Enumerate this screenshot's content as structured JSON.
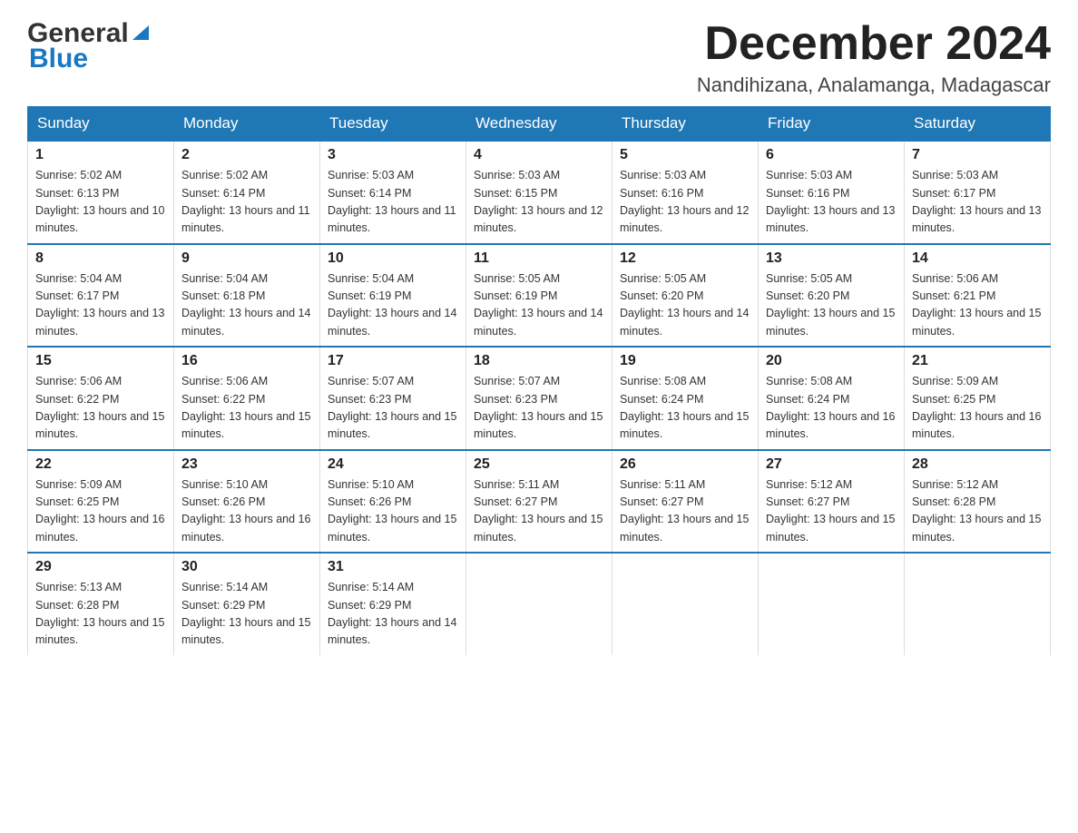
{
  "logo": {
    "general": "General",
    "blue": "Blue"
  },
  "title": "December 2024",
  "location": "Nandihizana, Analamanga, Madagascar",
  "weekdays": [
    "Sunday",
    "Monday",
    "Tuesday",
    "Wednesday",
    "Thursday",
    "Friday",
    "Saturday"
  ],
  "weeks": [
    [
      {
        "day": "1",
        "sunrise": "5:02 AM",
        "sunset": "6:13 PM",
        "daylight": "13 hours and 10 minutes."
      },
      {
        "day": "2",
        "sunrise": "5:02 AM",
        "sunset": "6:14 PM",
        "daylight": "13 hours and 11 minutes."
      },
      {
        "day": "3",
        "sunrise": "5:03 AM",
        "sunset": "6:14 PM",
        "daylight": "13 hours and 11 minutes."
      },
      {
        "day": "4",
        "sunrise": "5:03 AM",
        "sunset": "6:15 PM",
        "daylight": "13 hours and 12 minutes."
      },
      {
        "day": "5",
        "sunrise": "5:03 AM",
        "sunset": "6:16 PM",
        "daylight": "13 hours and 12 minutes."
      },
      {
        "day": "6",
        "sunrise": "5:03 AM",
        "sunset": "6:16 PM",
        "daylight": "13 hours and 13 minutes."
      },
      {
        "day": "7",
        "sunrise": "5:03 AM",
        "sunset": "6:17 PM",
        "daylight": "13 hours and 13 minutes."
      }
    ],
    [
      {
        "day": "8",
        "sunrise": "5:04 AM",
        "sunset": "6:17 PM",
        "daylight": "13 hours and 13 minutes."
      },
      {
        "day": "9",
        "sunrise": "5:04 AM",
        "sunset": "6:18 PM",
        "daylight": "13 hours and 14 minutes."
      },
      {
        "day": "10",
        "sunrise": "5:04 AM",
        "sunset": "6:19 PM",
        "daylight": "13 hours and 14 minutes."
      },
      {
        "day": "11",
        "sunrise": "5:05 AM",
        "sunset": "6:19 PM",
        "daylight": "13 hours and 14 minutes."
      },
      {
        "day": "12",
        "sunrise": "5:05 AM",
        "sunset": "6:20 PM",
        "daylight": "13 hours and 14 minutes."
      },
      {
        "day": "13",
        "sunrise": "5:05 AM",
        "sunset": "6:20 PM",
        "daylight": "13 hours and 15 minutes."
      },
      {
        "day": "14",
        "sunrise": "5:06 AM",
        "sunset": "6:21 PM",
        "daylight": "13 hours and 15 minutes."
      }
    ],
    [
      {
        "day": "15",
        "sunrise": "5:06 AM",
        "sunset": "6:22 PM",
        "daylight": "13 hours and 15 minutes."
      },
      {
        "day": "16",
        "sunrise": "5:06 AM",
        "sunset": "6:22 PM",
        "daylight": "13 hours and 15 minutes."
      },
      {
        "day": "17",
        "sunrise": "5:07 AM",
        "sunset": "6:23 PM",
        "daylight": "13 hours and 15 minutes."
      },
      {
        "day": "18",
        "sunrise": "5:07 AM",
        "sunset": "6:23 PM",
        "daylight": "13 hours and 15 minutes."
      },
      {
        "day": "19",
        "sunrise": "5:08 AM",
        "sunset": "6:24 PM",
        "daylight": "13 hours and 15 minutes."
      },
      {
        "day": "20",
        "sunrise": "5:08 AM",
        "sunset": "6:24 PM",
        "daylight": "13 hours and 16 minutes."
      },
      {
        "day": "21",
        "sunrise": "5:09 AM",
        "sunset": "6:25 PM",
        "daylight": "13 hours and 16 minutes."
      }
    ],
    [
      {
        "day": "22",
        "sunrise": "5:09 AM",
        "sunset": "6:25 PM",
        "daylight": "13 hours and 16 minutes."
      },
      {
        "day": "23",
        "sunrise": "5:10 AM",
        "sunset": "6:26 PM",
        "daylight": "13 hours and 16 minutes."
      },
      {
        "day": "24",
        "sunrise": "5:10 AM",
        "sunset": "6:26 PM",
        "daylight": "13 hours and 15 minutes."
      },
      {
        "day": "25",
        "sunrise": "5:11 AM",
        "sunset": "6:27 PM",
        "daylight": "13 hours and 15 minutes."
      },
      {
        "day": "26",
        "sunrise": "5:11 AM",
        "sunset": "6:27 PM",
        "daylight": "13 hours and 15 minutes."
      },
      {
        "day": "27",
        "sunrise": "5:12 AM",
        "sunset": "6:27 PM",
        "daylight": "13 hours and 15 minutes."
      },
      {
        "day": "28",
        "sunrise": "5:12 AM",
        "sunset": "6:28 PM",
        "daylight": "13 hours and 15 minutes."
      }
    ],
    [
      {
        "day": "29",
        "sunrise": "5:13 AM",
        "sunset": "6:28 PM",
        "daylight": "13 hours and 15 minutes."
      },
      {
        "day": "30",
        "sunrise": "5:14 AM",
        "sunset": "6:29 PM",
        "daylight": "13 hours and 15 minutes."
      },
      {
        "day": "31",
        "sunrise": "5:14 AM",
        "sunset": "6:29 PM",
        "daylight": "13 hours and 14 minutes."
      },
      null,
      null,
      null,
      null
    ]
  ]
}
